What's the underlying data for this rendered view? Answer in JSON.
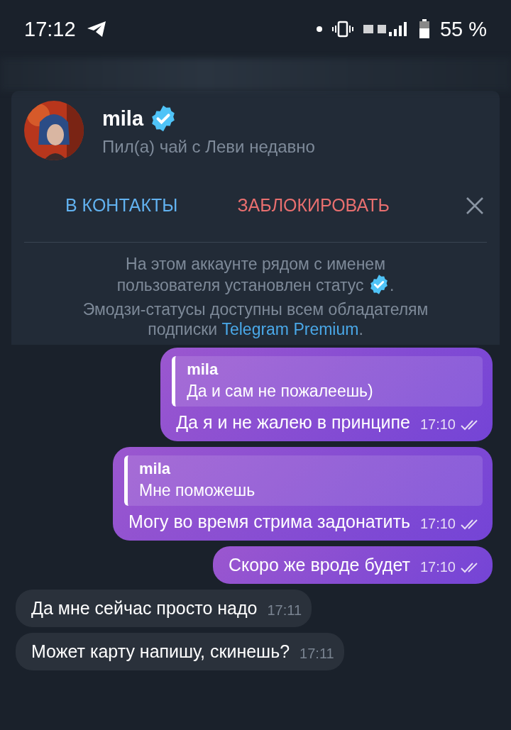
{
  "status_bar": {
    "time": "17:12",
    "battery": "55 %"
  },
  "contact": {
    "name": "mila",
    "verified": true,
    "status": "Пил(а) чай с Леви недавно"
  },
  "actions": [
    {
      "kind": "add",
      "label": "В КОНТАКТЫ"
    },
    {
      "kind": "block",
      "label": "ЗАБЛОКИРОВАТЬ"
    }
  ],
  "notice": {
    "line1": "На этом аккаунте рядом с именем пользователя установлен статус",
    "after_icon": ".",
    "line2": "Эмодзи-статусы доступны всем обладателям подписки",
    "link": "Telegram Premium",
    "end": "."
  },
  "messages": [
    {
      "outgoing": true,
      "reply": {
        "author": "mila",
        "text": "Да и сам не пожалеешь)"
      },
      "text": "Да я и не жалею в принципе",
      "time": "17:10",
      "read": true
    },
    {
      "outgoing": true,
      "reply": {
        "author": "mila",
        "text": "Мне поможешь"
      },
      "text": "Могу во время стрима задонатить",
      "time": "17:10",
      "read": true
    },
    {
      "outgoing": true,
      "text": "Скоро же вроде будет",
      "time": "17:10",
      "read": true
    },
    {
      "outgoing": false,
      "text": "Да мне сейчас просто надо",
      "time": "17:11"
    },
    {
      "outgoing": false,
      "text": "Может карту напишу, скинешь?",
      "time": "17:11"
    }
  ]
}
